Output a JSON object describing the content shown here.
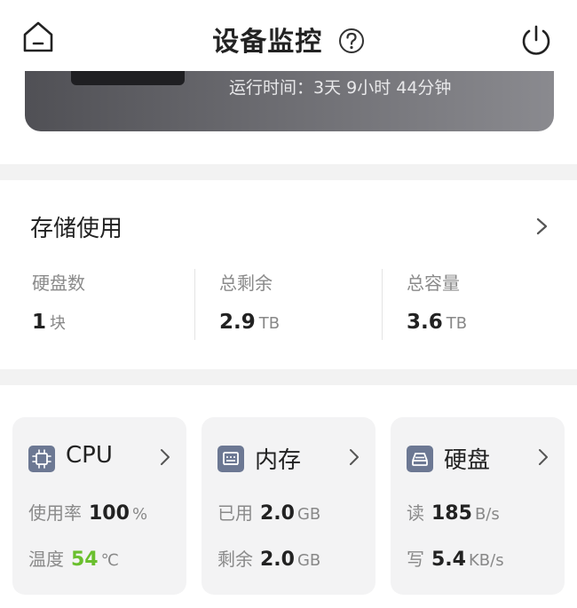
{
  "header": {
    "title": "设备监控"
  },
  "device": {
    "uptime": "运行时间：3天 9小时 44分钟"
  },
  "storage": {
    "title": "存储使用",
    "stats": [
      {
        "label": "硬盘数",
        "value": "1",
        "unit": "块"
      },
      {
        "label": "总剩余",
        "value": "2.9",
        "unit": "TB"
      },
      {
        "label": "总容量",
        "value": "3.6",
        "unit": "TB"
      }
    ]
  },
  "tiles": {
    "cpu": {
      "title": "CPU",
      "rows": [
        {
          "label": "使用率",
          "value": "100",
          "unit": "%"
        },
        {
          "label": "温度",
          "value": "54",
          "unit": "℃"
        }
      ]
    },
    "memory": {
      "title": "内存",
      "rows": [
        {
          "label": "已用",
          "value": "2.0",
          "unit": "GB"
        },
        {
          "label": "剩余",
          "value": "2.0",
          "unit": "GB"
        }
      ]
    },
    "disk": {
      "title": "硬盘",
      "rows": [
        {
          "label": "读",
          "value": "185",
          "unit": "B/s"
        },
        {
          "label": "写",
          "value": "5.4",
          "unit": "KB/s"
        }
      ]
    }
  },
  "colors": {
    "temperature_ok": "#6abf2e",
    "tile_icon_bg": "#6c7893",
    "banner": "#6b6b70"
  },
  "icons": [
    "home-icon",
    "help-icon",
    "power-icon",
    "chevron-right-icon",
    "cpu-icon",
    "memory-icon",
    "disk-icon"
  ]
}
